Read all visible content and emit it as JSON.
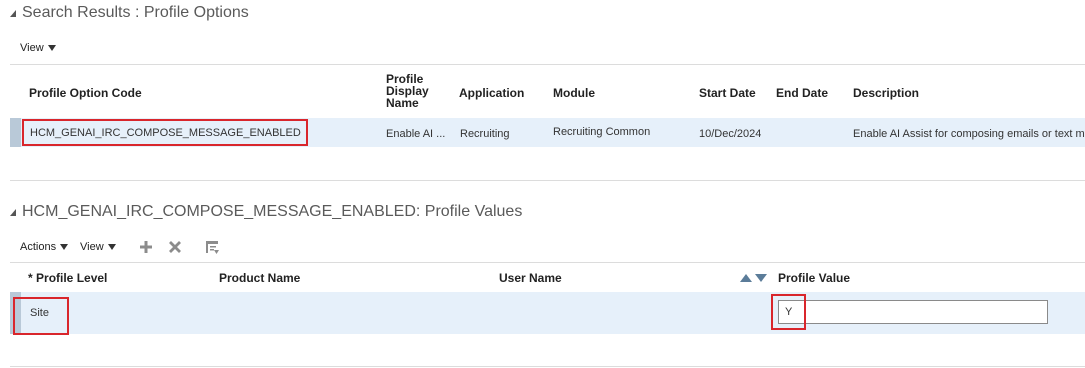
{
  "search_section": {
    "title": "Search Results : Profile Options",
    "view_menu": "View",
    "columns": {
      "code": "Profile Option Code",
      "display_name": "Profile Display Name",
      "application": "Application",
      "module": "Module",
      "start_date": "Start Date",
      "end_date": "End Date",
      "description": "Description"
    },
    "row": {
      "code": "HCM_GENAI_IRC_COMPOSE_MESSAGE_ENABLED",
      "display_name": "Enable AI ...",
      "application": "Recruiting",
      "module": "Recruiting Common",
      "start_date": "10/Dec/2024",
      "end_date": "",
      "description": "Enable AI Assist for composing emails or text me"
    }
  },
  "values_section": {
    "title": "HCM_GENAI_IRC_COMPOSE_MESSAGE_ENABLED: Profile Values",
    "actions_menu": "Actions",
    "view_menu": "View",
    "columns": {
      "required_marker": "*",
      "profile_level": "Profile Level",
      "product_name": "Product Name",
      "user_name": "User Name",
      "profile_value": "Profile Value"
    },
    "row": {
      "profile_level": "Site",
      "product_name": "",
      "user_name": "",
      "profile_value": "Y"
    }
  },
  "icons": {
    "add": "plus-icon",
    "delete": "x-icon",
    "detach": "detach-table-icon",
    "sort": "sort-arrows-icon"
  },
  "colors": {
    "highlight_border": "#d9262c",
    "selected_row": "#e6f0fa",
    "icon_gray": "#8c8c8c"
  }
}
